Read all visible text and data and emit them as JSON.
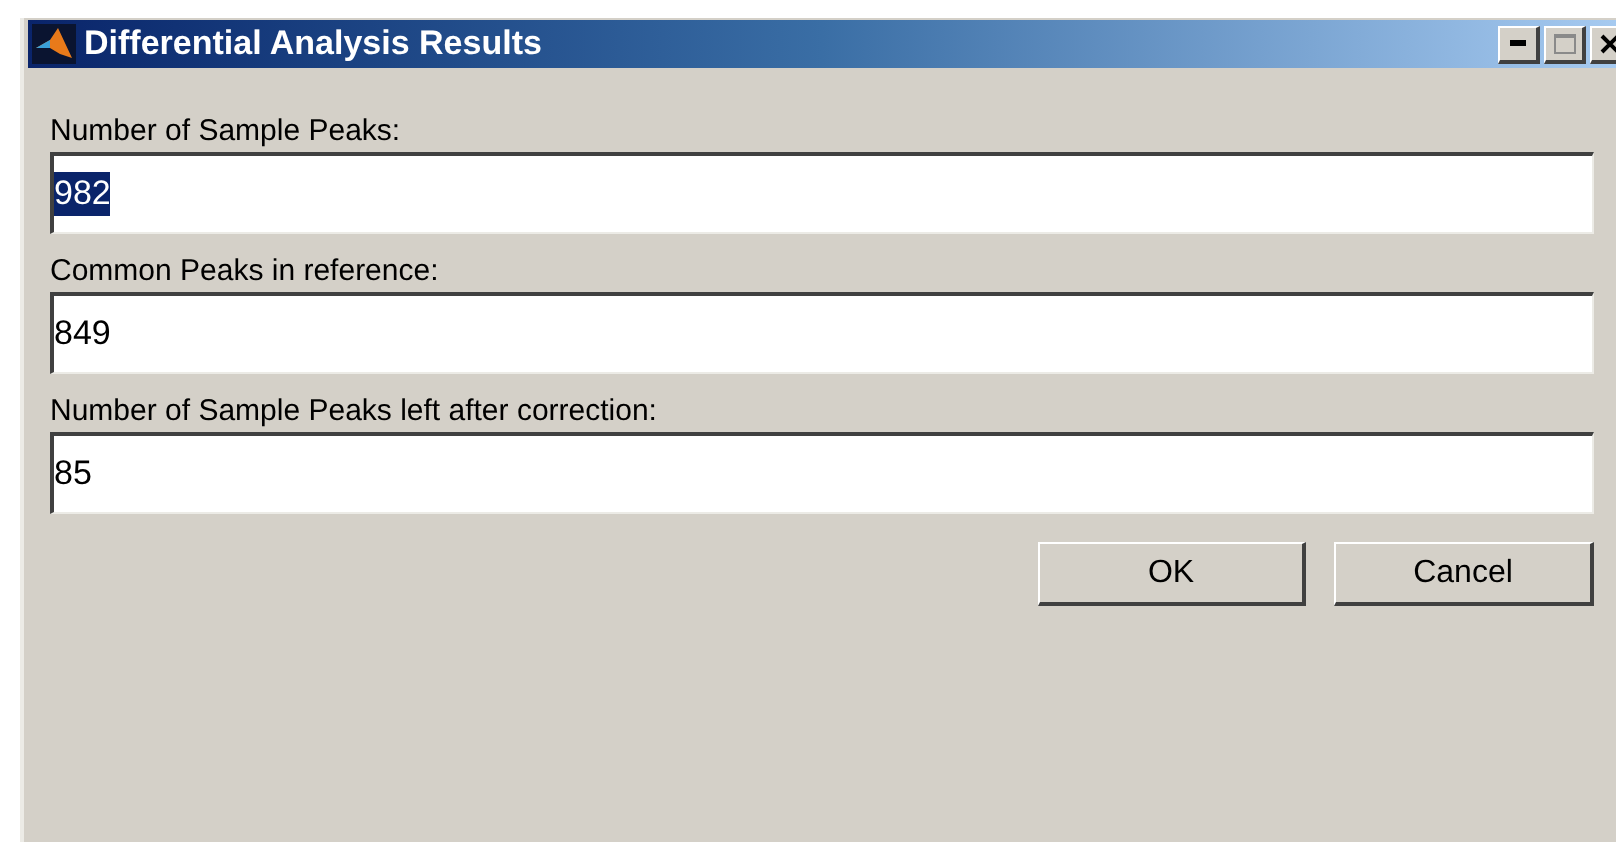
{
  "window": {
    "title": "Differential Analysis Results"
  },
  "fields": [
    {
      "label": "Number of Sample Peaks:",
      "value": "982",
      "text_selected": true
    },
    {
      "label": "Common Peaks in reference:",
      "value": "849",
      "text_selected": false
    },
    {
      "label": "Number of Sample Peaks left after correction:",
      "value": "85",
      "text_selected": false
    }
  ],
  "buttons": [
    "OK",
    "Cancel"
  ]
}
